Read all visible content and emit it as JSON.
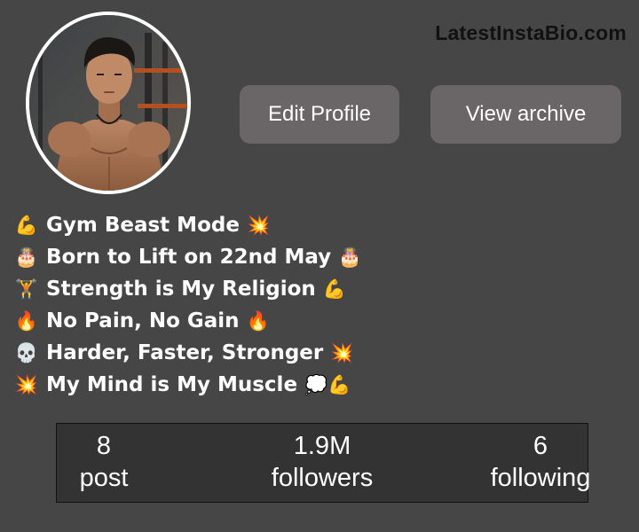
{
  "watermark": "LatestInstaBio.com",
  "profile": {
    "avatar_alt": "profile photo"
  },
  "buttons": {
    "edit_profile": "Edit Profile",
    "view_archive": "View archive"
  },
  "bio": [
    {
      "lead": "💪",
      "text": "Gym Beast Mode",
      "trail": "💥"
    },
    {
      "lead": "🎂",
      "text": "Born to Lift on 22nd May",
      "trail": "🎂"
    },
    {
      "lead": "🏋️",
      "text": "Strength is My Religion",
      "trail": "💪"
    },
    {
      "lead": "🔥",
      "text": "No Pain, No Gain",
      "trail": "🔥"
    },
    {
      "lead": "💀",
      "text": "Harder, Faster, Stronger",
      "trail": "💥"
    },
    {
      "lead": "💥",
      "text": "My Mind is My Muscle",
      "trail": "💭💪"
    }
  ],
  "stats": {
    "post": {
      "value": "8",
      "label": "post"
    },
    "followers": {
      "value": "1.9M",
      "label": "followers"
    },
    "following": {
      "value": "6",
      "label": "following"
    }
  },
  "colors": {
    "background": "#464646",
    "button": "#6a6566",
    "stats_box": "#333333",
    "text": "#ffffff",
    "watermark": "#111111"
  }
}
